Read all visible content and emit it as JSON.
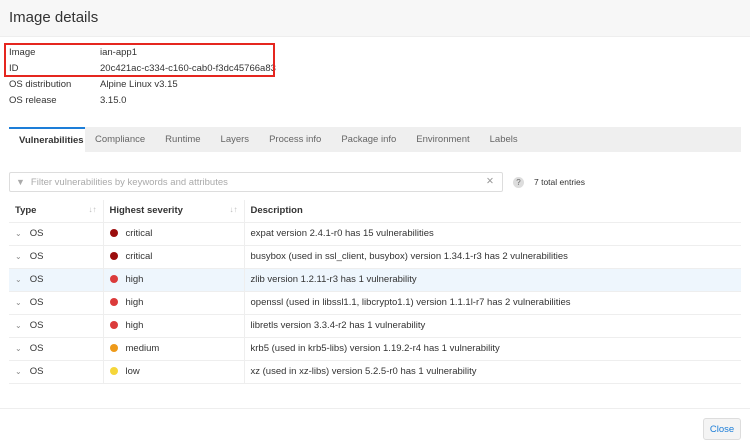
{
  "title": "Image details",
  "info": [
    {
      "label": "Image",
      "value": "ian-app1"
    },
    {
      "label": "ID",
      "value": "20c421ac-c334-c160-cab0-f3dc45766a83"
    },
    {
      "label": "OS distribution",
      "value": "Alpine Linux v3.15"
    },
    {
      "label": "OS release",
      "value": "3.15.0"
    }
  ],
  "tabs": [
    "Vulnerabilities",
    "Compliance",
    "Runtime",
    "Layers",
    "Process info",
    "Package info",
    "Environment",
    "Labels"
  ],
  "active_tab": "Vulnerabilities",
  "filter": {
    "placeholder": "Filter vulnerabilities by keywords and attributes",
    "value": ""
  },
  "total_entries": "7 total entries",
  "table": {
    "columns": [
      "Type",
      "Highest severity",
      "Description"
    ],
    "rows": [
      {
        "type": "OS",
        "severity": "critical",
        "color": "#9b0d0d",
        "description": "expat version 2.4.1-r0 has 15 vulnerabilities"
      },
      {
        "type": "OS",
        "severity": "critical",
        "color": "#9b0d0d",
        "description": "busybox (used in ssl_client, busybox) version 1.34.1-r3 has 2 vulnerabilities"
      },
      {
        "type": "OS",
        "severity": "high",
        "color": "#db3b3b",
        "description": "zlib version 1.2.11-r3 has 1 vulnerability",
        "selected": true
      },
      {
        "type": "OS",
        "severity": "high",
        "color": "#db3b3b",
        "description": "openssl (used in libssl1.1, libcrypto1.1) version 1.1.1l-r7 has 2 vulnerabilities"
      },
      {
        "type": "OS",
        "severity": "high",
        "color": "#db3b3b",
        "description": "libretls version 3.3.4-r2 has 1 vulnerability"
      },
      {
        "type": "OS",
        "severity": "medium",
        "color": "#ee9a1a",
        "description": "krb5 (used in krb5-libs) version 1.19.2-r4 has 1 vulnerability"
      },
      {
        "type": "OS",
        "severity": "low",
        "color": "#f5d63a",
        "description": "xz (used in xz-libs) version 5.2.5-r0 has 1 vulnerability"
      }
    ]
  },
  "close_label": "Close"
}
